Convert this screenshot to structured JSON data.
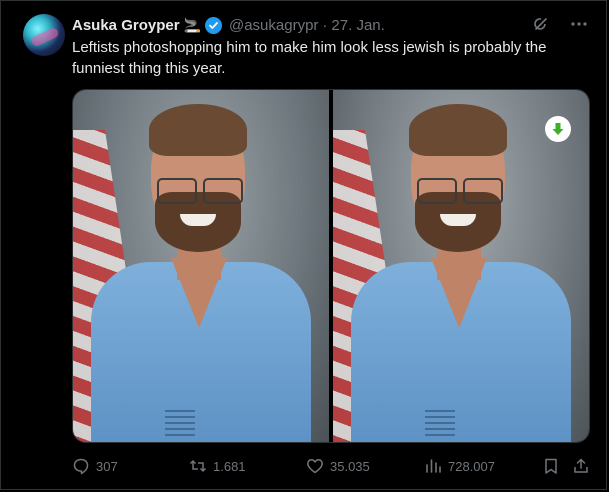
{
  "author": {
    "name": "Asuka Groyper",
    "badge_emoji": "🚬",
    "handle": "@asukagrypr",
    "separator": "·",
    "date": "27. Jan."
  },
  "icons": {
    "verified": "verified-check-icon",
    "grok": "grok-icon",
    "more": "more-horizontal-icon",
    "download": "download-arrow-icon",
    "reply": "reply-icon",
    "repost": "repost-icon",
    "like": "heart-icon",
    "views": "views-bar-chart-icon",
    "bookmark": "bookmark-icon",
    "share": "share-icon"
  },
  "tweet": {
    "text": "Leftists photoshopping him to make him look less jewish is probably the funniest thing this year."
  },
  "stats": {
    "replies": "307",
    "reposts": "1.681",
    "likes": "35.035",
    "views": "728.007"
  },
  "colors": {
    "background": "#000000",
    "text": "#e7e9ea",
    "muted": "#71767b",
    "verified": "#1d9bf0",
    "download": "#3fae2a",
    "border": "#2f3336"
  }
}
